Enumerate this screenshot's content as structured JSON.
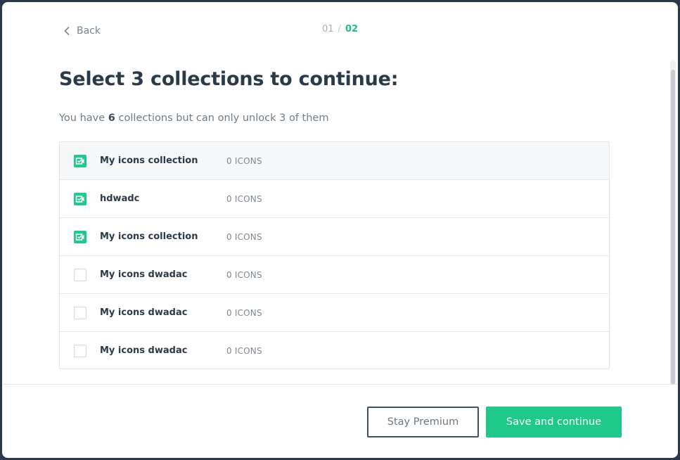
{
  "nav": {
    "back_label": "Back",
    "steps": {
      "first": "01",
      "separator": "/",
      "current": "02"
    }
  },
  "header": {
    "title": "Select 3 collections to continue:",
    "subtitle_prefix": "You have ",
    "subtitle_count": "6",
    "subtitle_suffix": " collections but can only unlock 3 of them"
  },
  "collections": [
    {
      "name": "My icons collection",
      "count": "0 ICONS",
      "checked": true
    },
    {
      "name": "hdwadc",
      "count": "0 ICONS",
      "checked": true
    },
    {
      "name": "My icons collection",
      "count": "0 ICONS",
      "checked": true
    },
    {
      "name": "My icons dwadac",
      "count": "0 ICONS",
      "checked": false
    },
    {
      "name": "My icons dwadac",
      "count": "0 ICONS",
      "checked": false
    },
    {
      "name": "My icons dwadac",
      "count": "0 ICONS",
      "checked": false
    }
  ],
  "footer": {
    "secondary_label": "Stay Premium",
    "primary_label": "Save and continue"
  },
  "colors": {
    "accent": "#1ec98a",
    "title": "#293a4a",
    "backdrop": "#2b3a4a"
  },
  "icons": {
    "back": "chevron-left-icon",
    "checked": "checkmark-icon"
  }
}
